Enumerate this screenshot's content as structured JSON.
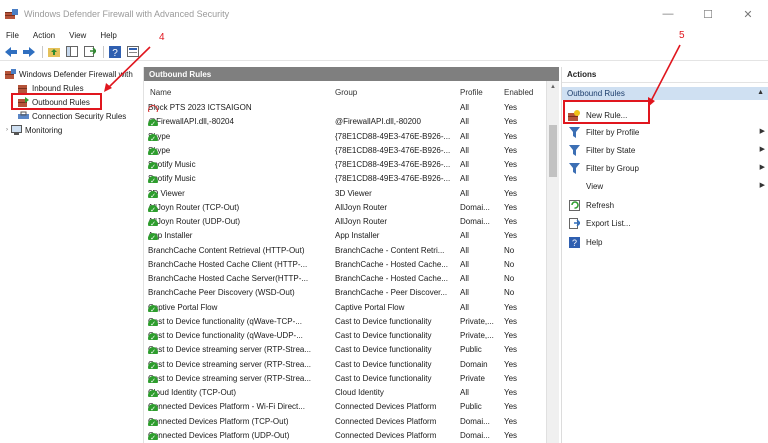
{
  "window": {
    "title": "Windows Defender Firewall with Advanced Security",
    "minimize": "—",
    "maximize": "☐",
    "close": "✕"
  },
  "menu": [
    "File",
    "Action",
    "View",
    "Help"
  ],
  "tree": {
    "root": "Windows Defender Firewall with",
    "items": [
      "Inbound Rules",
      "Outbound Rules",
      "Connection Security Rules",
      "Monitoring"
    ]
  },
  "center": {
    "title": "Outbound Rules",
    "columns": {
      "name": "Name",
      "group": "Group",
      "profile": "Profile",
      "enabled": "Enabled"
    },
    "rows": [
      {
        "status": "block",
        "name": "Block PTS 2023 ICTSAIGON",
        "group": "",
        "profile": "All",
        "enabled": "Yes"
      },
      {
        "status": "allow",
        "name": "@FirewallAPI.dll,-80204",
        "group": "@FirewallAPI.dll,-80200",
        "profile": "All",
        "enabled": "Yes"
      },
      {
        "status": "allow",
        "name": "Skype",
        "group": "{78E1CD88-49E3-476E-B926-...",
        "profile": "All",
        "enabled": "Yes"
      },
      {
        "status": "allow",
        "name": "Skype",
        "group": "{78E1CD88-49E3-476E-B926-...",
        "profile": "All",
        "enabled": "Yes"
      },
      {
        "status": "allow",
        "name": "Spotify Music",
        "group": "{78E1CD88-49E3-476E-B926-...",
        "profile": "All",
        "enabled": "Yes"
      },
      {
        "status": "allow",
        "name": "Spotify Music",
        "group": "{78E1CD88-49E3-476E-B926-...",
        "profile": "All",
        "enabled": "Yes"
      },
      {
        "status": "allow",
        "name": "3D Viewer",
        "group": "3D Viewer",
        "profile": "All",
        "enabled": "Yes"
      },
      {
        "status": "allow",
        "name": "AllJoyn Router (TCP-Out)",
        "group": "AllJoyn Router",
        "profile": "Domai...",
        "enabled": "Yes"
      },
      {
        "status": "allow",
        "name": "AllJoyn Router (UDP-Out)",
        "group": "AllJoyn Router",
        "profile": "Domai...",
        "enabled": "Yes"
      },
      {
        "status": "allow",
        "name": "App Installer",
        "group": "App Installer",
        "profile": "All",
        "enabled": "Yes"
      },
      {
        "status": "none",
        "name": "BranchCache Content Retrieval (HTTP-Out)",
        "group": "BranchCache - Content Retri...",
        "profile": "All",
        "enabled": "No"
      },
      {
        "status": "none",
        "name": "BranchCache Hosted Cache Client (HTTP-...",
        "group": "BranchCache - Hosted Cache...",
        "profile": "All",
        "enabled": "No"
      },
      {
        "status": "none",
        "name": "BranchCache Hosted Cache Server(HTTP-...",
        "group": "BranchCache - Hosted Cache...",
        "profile": "All",
        "enabled": "No"
      },
      {
        "status": "none",
        "name": "BranchCache Peer Discovery (WSD-Out)",
        "group": "BranchCache - Peer Discover...",
        "profile": "All",
        "enabled": "No"
      },
      {
        "status": "allow",
        "name": "Captive Portal Flow",
        "group": "Captive Portal Flow",
        "profile": "All",
        "enabled": "Yes"
      },
      {
        "status": "allow",
        "name": "Cast to Device functionality (qWave-TCP-...",
        "group": "Cast to Device functionality",
        "profile": "Private,...",
        "enabled": "Yes"
      },
      {
        "status": "allow",
        "name": "Cast to Device functionality (qWave-UDP-...",
        "group": "Cast to Device functionality",
        "profile": "Private,...",
        "enabled": "Yes"
      },
      {
        "status": "allow",
        "name": "Cast to Device streaming server (RTP-Strea...",
        "group": "Cast to Device functionality",
        "profile": "Public",
        "enabled": "Yes"
      },
      {
        "status": "allow",
        "name": "Cast to Device streaming server (RTP-Strea...",
        "group": "Cast to Device functionality",
        "profile": "Domain",
        "enabled": "Yes"
      },
      {
        "status": "allow",
        "name": "Cast to Device streaming server (RTP-Strea...",
        "group": "Cast to Device functionality",
        "profile": "Private",
        "enabled": "Yes"
      },
      {
        "status": "allow",
        "name": "Cloud Identity (TCP-Out)",
        "group": "Cloud Identity",
        "profile": "All",
        "enabled": "Yes"
      },
      {
        "status": "allow",
        "name": "Connected Devices Platform - Wi-Fi Direct...",
        "group": "Connected Devices Platform",
        "profile": "Public",
        "enabled": "Yes"
      },
      {
        "status": "allow",
        "name": "Connected Devices Platform (TCP-Out)",
        "group": "Connected Devices Platform",
        "profile": "Domai...",
        "enabled": "Yes"
      },
      {
        "status": "allow",
        "name": "Connected Devices Platform (UDP-Out)",
        "group": "Connected Devices Platform",
        "profile": "Domai...",
        "enabled": "Yes"
      }
    ]
  },
  "actions": {
    "header": "Actions",
    "section": "Outbound Rules",
    "items": [
      {
        "label": "New Rule...",
        "icon": "new-rule-icon",
        "submenu": false
      },
      {
        "label": "Filter by Profile",
        "icon": "filter-icon",
        "submenu": true
      },
      {
        "label": "Filter by State",
        "icon": "filter-icon",
        "submenu": true
      },
      {
        "label": "Filter by Group",
        "icon": "filter-icon",
        "submenu": true
      },
      {
        "label": "View",
        "icon": "",
        "submenu": true
      },
      {
        "label": "Refresh",
        "icon": "refresh-icon",
        "submenu": false
      },
      {
        "label": "Export List...",
        "icon": "export-icon",
        "submenu": false
      },
      {
        "label": "Help",
        "icon": "help-icon",
        "submenu": false
      }
    ]
  },
  "annotations": {
    "step4": "4",
    "step5": "5"
  },
  "colors": {
    "annotation": "#e0161e",
    "allow": "#2e9d2e",
    "block": "#d43030",
    "section": "#cfe0f2",
    "pane_header": "#7f7f7f"
  }
}
